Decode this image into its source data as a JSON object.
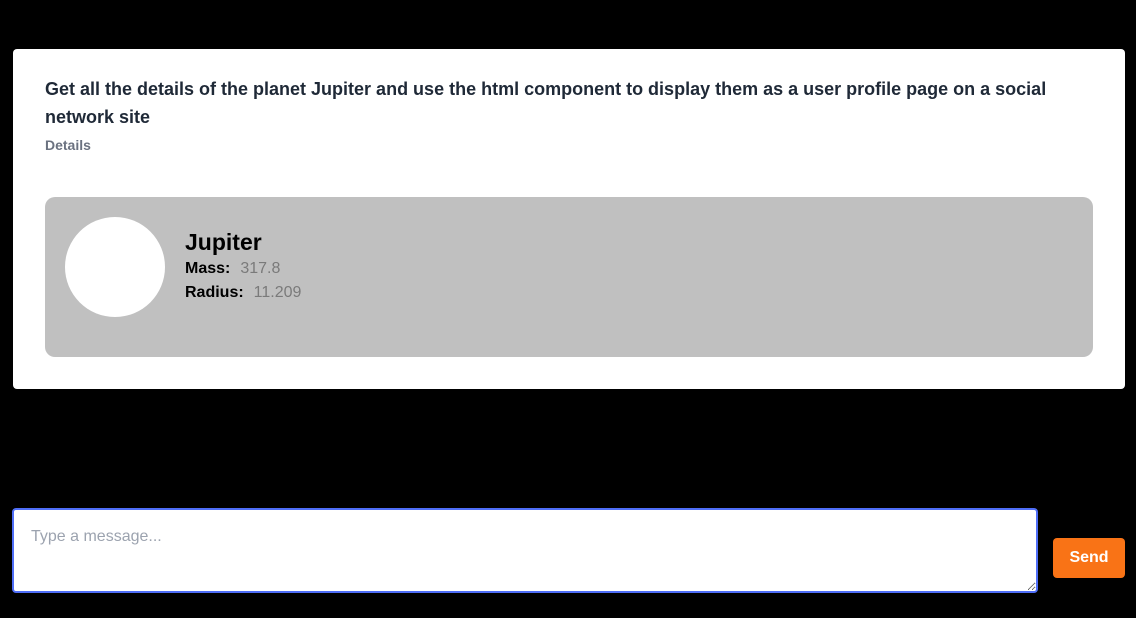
{
  "message": {
    "prompt": "Get all the details of the planet Jupiter and use the html component to display them as a user profile page on a social network site",
    "details_label": "Details"
  },
  "profile": {
    "name": "Jupiter",
    "mass_label": "Mass:",
    "mass_value": "317.8",
    "radius_label": "Radius:",
    "radius_value": "11.209"
  },
  "composer": {
    "placeholder": "Type a message...",
    "value": "",
    "send_label": "Send"
  },
  "colors": {
    "background": "#000000",
    "card": "#ffffff",
    "profile_bg": "#c0c0c0",
    "send_button": "#f97316",
    "input_focus_border": "#4f6ef7"
  }
}
